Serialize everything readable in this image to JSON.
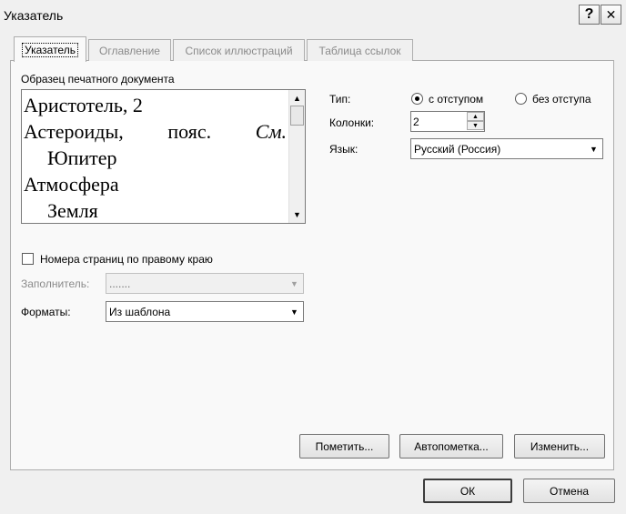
{
  "window": {
    "title": "Указатель",
    "help_label": "?",
    "close_label": "✕"
  },
  "tabs": [
    {
      "label": "Указатель",
      "active": true
    },
    {
      "label": "Оглавление",
      "active": false
    },
    {
      "label": "Список иллюстраций",
      "active": false
    },
    {
      "label": "Таблица ссылок",
      "active": false
    }
  ],
  "preview": {
    "label": "Образец печатного документа",
    "lines": [
      {
        "text": "Аристотель, 2"
      },
      {
        "parts": [
          "Астероиды,",
          "пояс.",
          "См."
        ]
      },
      {
        "text": "Юпитер"
      },
      {
        "text": "Атмосфера"
      },
      {
        "text": "Земля"
      }
    ]
  },
  "type": {
    "label": "Тип:",
    "options": [
      {
        "label": "с отступом",
        "selected": true
      },
      {
        "label": "без отступа",
        "selected": false
      }
    ]
  },
  "columns": {
    "label": "Колонки:",
    "value": "2"
  },
  "language": {
    "label": "Язык:",
    "value": "Русский (Россия)"
  },
  "page_numbers_right": {
    "label": "Номера страниц по правому краю",
    "checked": false
  },
  "leader": {
    "label": "Заполнитель:",
    "value": "......."
  },
  "formats": {
    "label": "Форматы:",
    "value": "Из шаблона"
  },
  "actions": {
    "mark_label": "Пометить...",
    "automark_label": "Автопометка...",
    "modify_label": "Изменить..."
  },
  "footer": {
    "ok_label": "ОК",
    "cancel_label": "Отмена"
  }
}
